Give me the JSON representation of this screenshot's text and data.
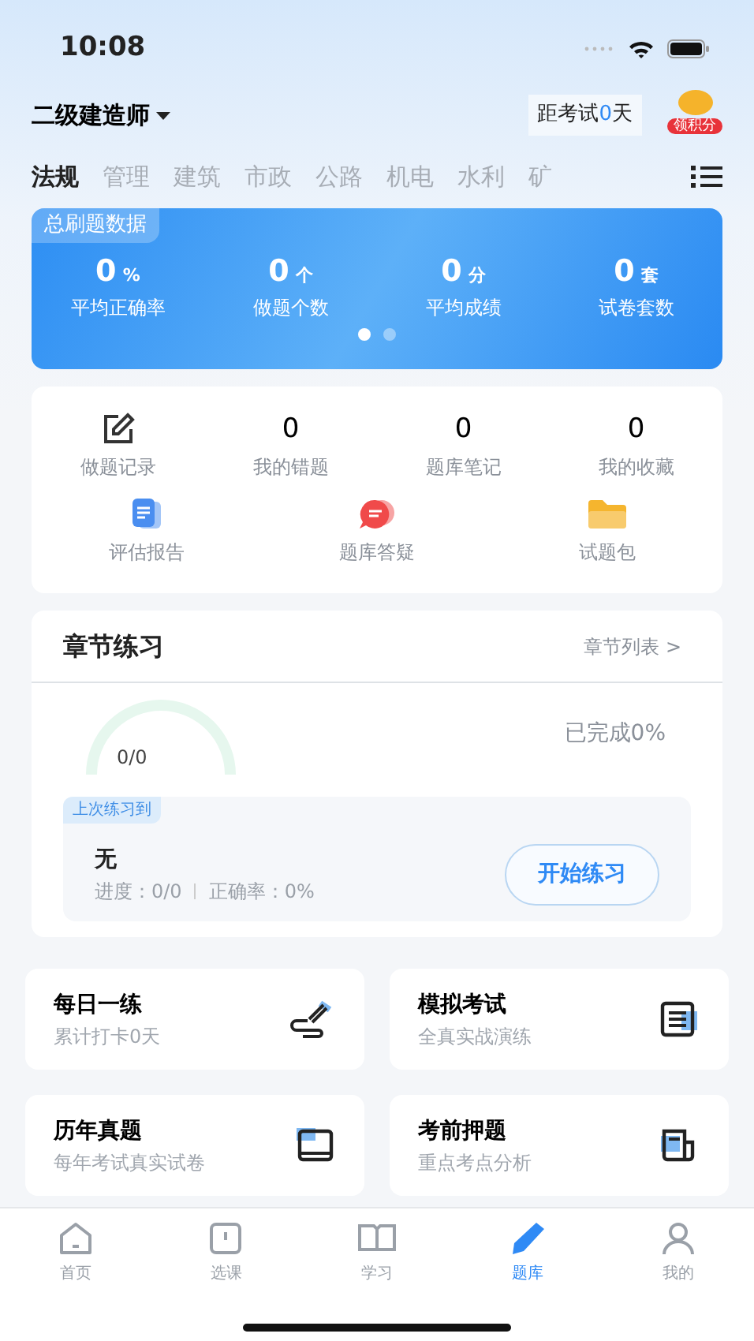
{
  "status_bar": {
    "time": "10:08"
  },
  "header": {
    "exam": "二级建造师",
    "countdown_prefix": "距考试",
    "countdown_days": "0",
    "countdown_suffix": "天",
    "points_badge": "领积分"
  },
  "tabs": [
    {
      "label": "法规",
      "selected": true
    },
    {
      "label": "管理",
      "selected": false
    },
    {
      "label": "建筑",
      "selected": false
    },
    {
      "label": "市政",
      "selected": false
    },
    {
      "label": "公路",
      "selected": false
    },
    {
      "label": "机电",
      "selected": false
    },
    {
      "label": "水利",
      "selected": false
    },
    {
      "label": "矿",
      "selected": false
    }
  ],
  "stats_card": {
    "tag": "总刷题数据",
    "stats": [
      {
        "value": "0",
        "unit": "%",
        "label": "平均正确率"
      },
      {
        "value": "0",
        "unit": "个",
        "label": "做题个数"
      },
      {
        "value": "0",
        "unit": "分",
        "label": "平均成绩"
      },
      {
        "value": "0",
        "unit": "套",
        "label": "试卷套数"
      }
    ],
    "pages": [
      {
        "selected": true
      },
      {
        "selected": false
      }
    ]
  },
  "shortcuts": [
    {
      "kind": "icon",
      "label": "做题记录"
    },
    {
      "kind": "count",
      "count": "0",
      "label": "我的错题"
    },
    {
      "kind": "count",
      "count": "0",
      "label": "题库笔记"
    },
    {
      "kind": "count",
      "count": "0",
      "label": "我的收藏"
    }
  ],
  "shortcuts_2": [
    {
      "label": "评估报告",
      "color": "#4a8ef0"
    },
    {
      "label": "题库答疑",
      "color": "#f04a4a"
    },
    {
      "label": "试题包",
      "color": "#f5b52e"
    }
  ],
  "chapter": {
    "title": "章节练习",
    "link": "章节列表 >",
    "gauge": {
      "reading": "0/0"
    },
    "completed": "已完成0%",
    "last_tag": "上次练习到",
    "last_name": "无",
    "progress": "进度：0/0",
    "accuracy": "正确率：0%",
    "button": "开始练习"
  },
  "features": [
    {
      "title": "每日一练",
      "subtitle": "累计打卡0天"
    },
    {
      "title": "模拟考试",
      "subtitle": "全真实战演练"
    },
    {
      "title": "历年真题",
      "subtitle": "每年考试真实试卷"
    },
    {
      "title": "考前押题",
      "subtitle": "重点考点分析"
    }
  ],
  "bottom_nav": [
    {
      "label": "首页",
      "selected": false
    },
    {
      "label": "选课",
      "selected": false
    },
    {
      "label": "学习",
      "selected": false
    },
    {
      "label": "题库",
      "selected": true
    },
    {
      "label": "我的",
      "selected": false
    }
  ]
}
